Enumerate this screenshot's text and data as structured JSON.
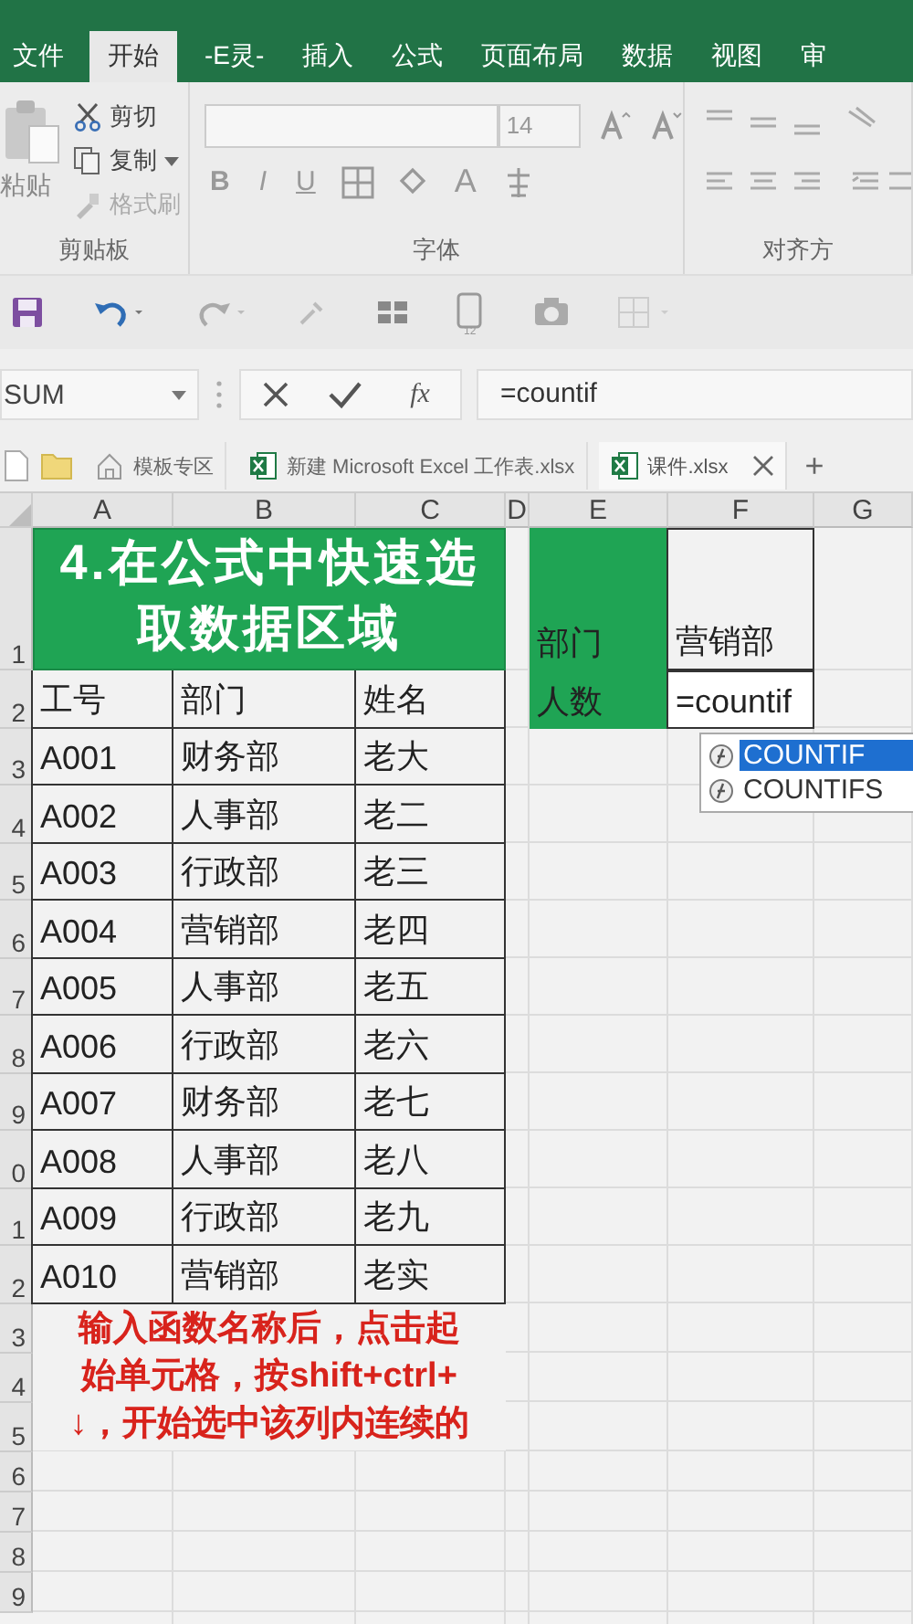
{
  "ribbon": {
    "tabs": [
      {
        "label": "文件",
        "selected": false
      },
      {
        "label": "开始",
        "selected": true
      },
      {
        "label": "-E灵-",
        "selected": false
      },
      {
        "label": "插入",
        "selected": false
      },
      {
        "label": "公式",
        "selected": false
      },
      {
        "label": "页面布局",
        "selected": false
      },
      {
        "label": "数据",
        "selected": false
      },
      {
        "label": "视图",
        "selected": false
      },
      {
        "label": "审",
        "selected": false
      }
    ],
    "clipboard": {
      "paste": "粘贴",
      "cut": "剪切",
      "copy": "复制",
      "format_painter": "格式刷",
      "group_label": "剪贴板"
    },
    "font": {
      "size": "14",
      "styles": [
        "B",
        "I",
        "U"
      ],
      "color_letter": "A",
      "group_label": "字体"
    },
    "alignment": {
      "group_label": "对齐方"
    }
  },
  "quick_access": {
    "badge": "12"
  },
  "formula_bar": {
    "name_box": "SUM",
    "fx": "fx",
    "formula": "=countif"
  },
  "doc_tabs": [
    {
      "label": "模板专区",
      "kind": "home",
      "selected": false
    },
    {
      "label": "新建 Microsoft Excel 工作表.xlsx",
      "kind": "excel",
      "selected": false
    },
    {
      "label": "课件.xlsx",
      "kind": "excel",
      "selected": true
    }
  ],
  "new_tab": "+",
  "sheet": {
    "columns": [
      "A",
      "B",
      "C",
      "D",
      "E",
      "F",
      "G"
    ],
    "row_numbers": [
      "1",
      "2",
      "3",
      "4",
      "5",
      "6",
      "7",
      "8",
      "9",
      "0",
      "1",
      "2",
      "3",
      "4",
      "5",
      "6",
      "7",
      "8",
      "9"
    ],
    "title_lines": [
      "4.在公式中快速选",
      "取数据区域"
    ],
    "headers": [
      "工号",
      "部门",
      "姓名"
    ],
    "rows": [
      [
        "A001",
        "财务部",
        "老大"
      ],
      [
        "A002",
        "人事部",
        "老二"
      ],
      [
        "A003",
        "行政部",
        "老三"
      ],
      [
        "A004",
        "营销部",
        "老四"
      ],
      [
        "A005",
        "人事部",
        "老五"
      ],
      [
        "A006",
        "行政部",
        "老六"
      ],
      [
        "A007",
        "财务部",
        "老七"
      ],
      [
        "A008",
        "人事部",
        "老八"
      ],
      [
        "A009",
        "行政部",
        "老九"
      ],
      [
        "A010",
        "营销部",
        "老实"
      ]
    ],
    "lookup": {
      "label_1": "部门",
      "value_1": "营销部",
      "label_2": "人数",
      "editing": "=countif"
    },
    "autocomplete": [
      {
        "label": "COUNTIF",
        "selected": true
      },
      {
        "label": "COUNTIFS",
        "selected": false
      }
    ],
    "note_lines": [
      "输入函数名称后，点击起",
      "始单元格，按shift+ctrl+",
      "↓，开始选中该列内连续的"
    ]
  }
}
